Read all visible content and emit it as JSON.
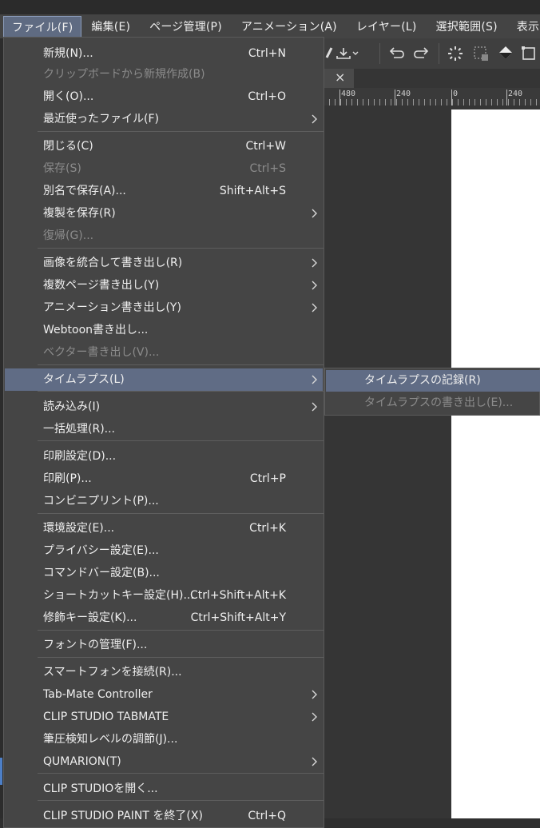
{
  "menubar": {
    "items": [
      "ファイル(F)",
      "編集(E)",
      "ページ管理(P)",
      "アニメーション(A)",
      "レイヤー(L)",
      "選択範囲(S)",
      "表示"
    ]
  },
  "document_tab": {
    "close_label": "×"
  },
  "ruler": {
    "labels": [
      "480",
      "240",
      "0",
      "240"
    ]
  },
  "file_menu": {
    "items": [
      {
        "label": "新規(N)...",
        "shortcut": "Ctrl+N",
        "disabled": false,
        "submenu": false
      },
      {
        "label": "クリップボードから新規作成(B)",
        "shortcut": "",
        "disabled": true,
        "submenu": false
      },
      {
        "label": "開く(O)...",
        "shortcut": "Ctrl+O",
        "disabled": false,
        "submenu": false
      },
      {
        "label": "最近使ったファイル(F)",
        "shortcut": "",
        "disabled": false,
        "submenu": true
      },
      {
        "label": "閉じる(C)",
        "shortcut": "Ctrl+W",
        "disabled": false,
        "submenu": false
      },
      {
        "label": "保存(S)",
        "shortcut": "Ctrl+S",
        "disabled": true,
        "submenu": false
      },
      {
        "label": "別名で保存(A)...",
        "shortcut": "Shift+Alt+S",
        "disabled": false,
        "submenu": false
      },
      {
        "label": "複製を保存(R)",
        "shortcut": "",
        "disabled": false,
        "submenu": true
      },
      {
        "label": "復帰(G)...",
        "shortcut": "",
        "disabled": true,
        "submenu": false
      },
      {
        "label": "画像を統合して書き出し(R)",
        "shortcut": "",
        "disabled": false,
        "submenu": true
      },
      {
        "label": "複数ページ書き出し(Y)",
        "shortcut": "",
        "disabled": false,
        "submenu": true
      },
      {
        "label": "アニメーション書き出し(Y)",
        "shortcut": "",
        "disabled": false,
        "submenu": true
      },
      {
        "label": "Webtoon書き出し...",
        "shortcut": "",
        "disabled": false,
        "submenu": false
      },
      {
        "label": "ベクター書き出し(V)...",
        "shortcut": "",
        "disabled": true,
        "submenu": false
      },
      {
        "label": "タイムラプス(L)",
        "shortcut": "",
        "disabled": false,
        "submenu": true,
        "highlighted": true
      },
      {
        "label": "読み込み(I)",
        "shortcut": "",
        "disabled": false,
        "submenu": true
      },
      {
        "label": "一括処理(R)...",
        "shortcut": "",
        "disabled": false,
        "submenu": false
      },
      {
        "label": "印刷設定(D)...",
        "shortcut": "",
        "disabled": false,
        "submenu": false
      },
      {
        "label": "印刷(P)...",
        "shortcut": "Ctrl+P",
        "disabled": false,
        "submenu": false
      },
      {
        "label": "コンビニプリント(P)...",
        "shortcut": "",
        "disabled": false,
        "submenu": false
      },
      {
        "label": "環境設定(E)...",
        "shortcut": "Ctrl+K",
        "disabled": false,
        "submenu": false
      },
      {
        "label": "プライバシー設定(E)...",
        "shortcut": "",
        "disabled": false,
        "submenu": false
      },
      {
        "label": "コマンドバー設定(B)...",
        "shortcut": "",
        "disabled": false,
        "submenu": false
      },
      {
        "label": "ショートカットキー設定(H)...",
        "shortcut": "Ctrl+Shift+Alt+K",
        "disabled": false,
        "submenu": false
      },
      {
        "label": "修飾キー設定(K)...",
        "shortcut": "Ctrl+Shift+Alt+Y",
        "disabled": false,
        "submenu": false
      },
      {
        "label": "フォントの管理(F)...",
        "shortcut": "",
        "disabled": false,
        "submenu": false
      },
      {
        "label": "スマートフォンを接続(R)...",
        "shortcut": "",
        "disabled": false,
        "submenu": false
      },
      {
        "label": "Tab-Mate Controller",
        "shortcut": "",
        "disabled": false,
        "submenu": true
      },
      {
        "label": "CLIP STUDIO TABMATE",
        "shortcut": "",
        "disabled": false,
        "submenu": true
      },
      {
        "label": "筆圧検知レベルの調節(J)...",
        "shortcut": "",
        "disabled": false,
        "submenu": false
      },
      {
        "label": "QUMARION(T)",
        "shortcut": "",
        "disabled": false,
        "submenu": true
      },
      {
        "label": "CLIP STUDIOを開く...",
        "shortcut": "",
        "disabled": false,
        "submenu": false
      },
      {
        "label": "CLIP STUDIO PAINT を終了(X)",
        "shortcut": "Ctrl+Q",
        "disabled": false,
        "submenu": false
      }
    ]
  },
  "timelapse_submenu": {
    "items": [
      {
        "label": "タイムラプスの記録(R)",
        "disabled": false,
        "highlighted": true
      },
      {
        "label": "タイムラプスの書き出し(E)...",
        "disabled": true,
        "highlighted": false
      }
    ]
  },
  "colors": {
    "menu_bg": "#454545",
    "highlight": "#606c85",
    "disabled_text": "#8b8b8b",
    "canvas_paper": "#ffffff"
  }
}
